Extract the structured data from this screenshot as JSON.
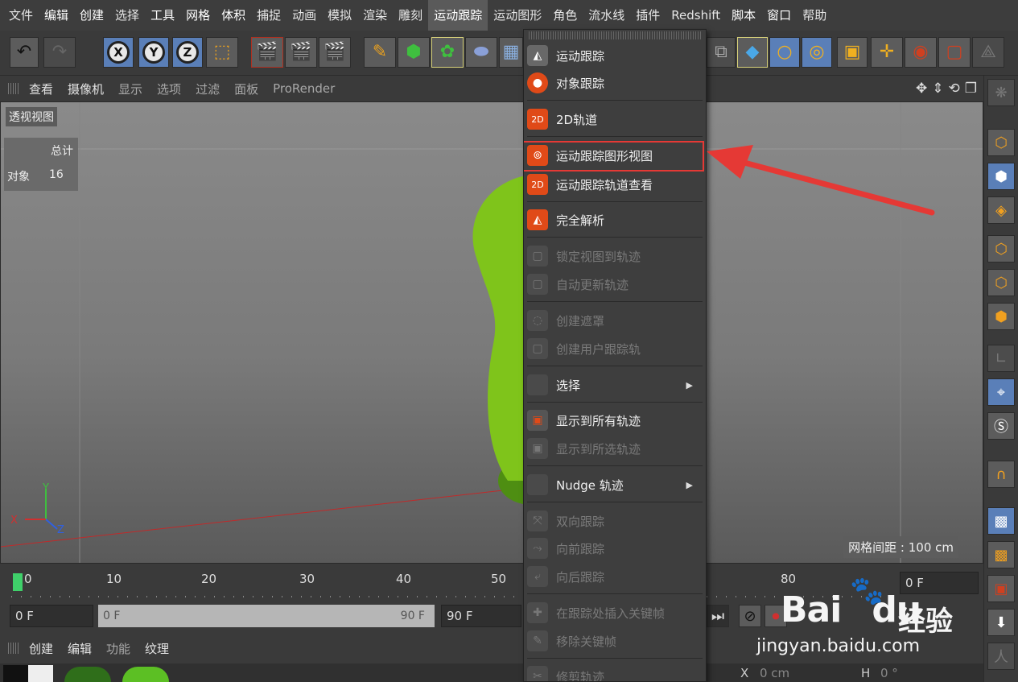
{
  "menubar": {
    "items": [
      "文件",
      "编辑",
      "创建",
      "选择",
      "工具",
      "网格",
      "体积",
      "捕捉",
      "动画",
      "模拟",
      "渲染",
      "雕刻",
      "运动跟踪",
      "运动图形",
      "角色",
      "流水线",
      "插件",
      "Redshift",
      "脚本",
      "窗口",
      "帮助"
    ]
  },
  "toolbar": {
    "axis_x": "X",
    "axis_y": "Y",
    "axis_z": "Z"
  },
  "viewport_menu": {
    "items": [
      "查看",
      "摄像机",
      "显示",
      "选项",
      "过滤",
      "面板",
      "ProRender"
    ]
  },
  "viewport": {
    "view_name": "透视视图",
    "stats_header": "总计",
    "stats_key": "对象",
    "stats_value": "16",
    "grid_spacing": "网格间距 : 100 cm",
    "axis_x": "X",
    "axis_y": "Y",
    "axis_z": "Z"
  },
  "timeline": {
    "ticks": [
      "0",
      "10",
      "20",
      "30",
      "40",
      "50",
      "80"
    ],
    "current_frame": "0 F"
  },
  "transport": {
    "start_field": "0 F",
    "slider_start": "0 F",
    "slider_end": "90 F",
    "end_field": "90 F"
  },
  "material_bar": {
    "items": [
      "创建",
      "编辑",
      "功能",
      "纹理"
    ]
  },
  "coords": {
    "x_label": "X",
    "x_value": "0 cm",
    "h_label": "H",
    "h_value": "0 °"
  },
  "dropdown": {
    "items": [
      {
        "label": "运动跟踪",
        "icon": "motion-tracker-icon",
        "enabled": true
      },
      {
        "label": "对象跟踪",
        "icon": "object-tracker-icon",
        "enabled": true
      },
      {
        "label": "2D轨道",
        "icon": "2d-track-icon",
        "enabled": true
      },
      {
        "label": "运动跟踪图形视图",
        "icon": "motion-graph-view-icon",
        "enabled": true,
        "highlighted": true
      },
      {
        "label": "运动跟踪轨道查看",
        "icon": "track-view-icon",
        "enabled": true
      },
      {
        "label": "完全解析",
        "icon": "full-solve-icon",
        "enabled": true
      },
      {
        "label": "锁定视图到轨迹",
        "icon": "lock-view-icon",
        "enabled": false
      },
      {
        "label": "自动更新轨迹",
        "icon": "auto-update-icon",
        "enabled": false
      },
      {
        "label": "创建遮罩",
        "icon": "create-mask-icon",
        "enabled": false
      },
      {
        "label": "创建用户跟踪轨",
        "icon": "create-user-track-icon",
        "enabled": false
      },
      {
        "label": "选择",
        "icon": "",
        "enabled": true,
        "submenu": true
      },
      {
        "label": "显示到所有轨迹",
        "icon": "show-all-tracks-icon",
        "enabled": true
      },
      {
        "label": "显示到所选轨迹",
        "icon": "show-selected-tracks-icon",
        "enabled": false
      },
      {
        "label": "Nudge 轨迹",
        "icon": "",
        "enabled": true,
        "submenu": true
      },
      {
        "label": "双向跟踪",
        "icon": "bidirectional-track-icon",
        "enabled": false
      },
      {
        "label": "向前跟踪",
        "icon": "forward-track-icon",
        "enabled": false
      },
      {
        "label": "向后跟踪",
        "icon": "backward-track-icon",
        "enabled": false
      },
      {
        "label": "在跟踪处插入关键帧",
        "icon": "insert-keyframe-icon",
        "enabled": false
      },
      {
        "label": "移除关键帧",
        "icon": "remove-keyframe-icon",
        "enabled": false
      },
      {
        "label": "修剪轨迹",
        "icon": "trim-track-icon",
        "enabled": false
      }
    ]
  },
  "watermark": {
    "brand": "Bai",
    "brand_suffix": "du",
    "jingyan": "经验",
    "url": "jingyan.baidu.com"
  },
  "colors": {
    "accent_orange": "#e04a18",
    "highlight_red": "#e53935",
    "playhead_green": "#3fd06a",
    "object_green": "#7fc41b"
  }
}
